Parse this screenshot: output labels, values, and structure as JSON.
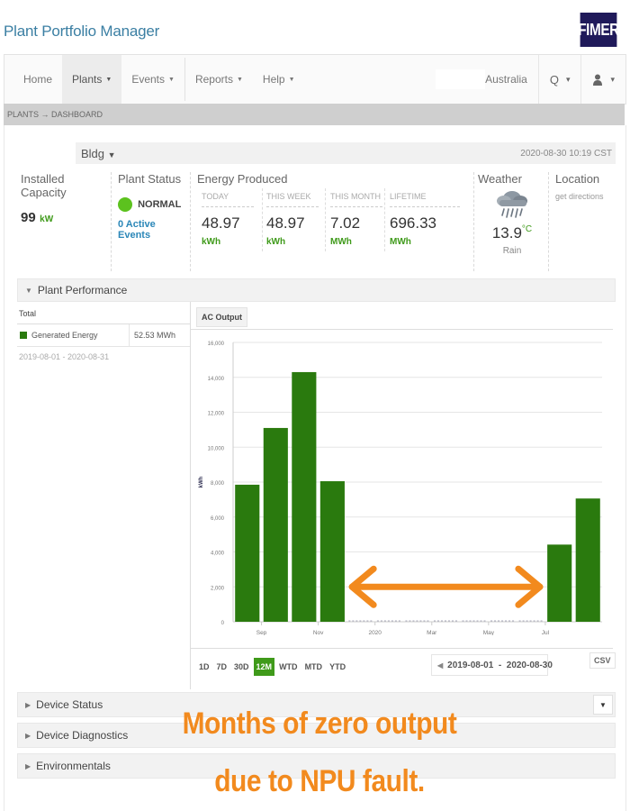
{
  "app": {
    "title": "Plant Portfolio Manager",
    "logo_text": "FIMER",
    "logo_color": "#201a5a"
  },
  "nav": {
    "items": [
      {
        "label": "Home",
        "has_caret": false
      },
      {
        "label": "Plants",
        "has_caret": true,
        "active": true
      },
      {
        "label": "Events",
        "has_caret": true
      },
      {
        "label": "Reports",
        "has_caret": true
      },
      {
        "label": "Help",
        "has_caret": true
      }
    ],
    "caret": "▼",
    "region": "Australia",
    "search_icon": "Q",
    "user_icon": "👤",
    "dropdown_caret": "▾"
  },
  "breadcrumb": {
    "text": "PLANTS → DASHBOARD"
  },
  "plant": {
    "name": "Bldg",
    "caret": "▼",
    "timestamp": "2020-08-30 10:19 CST"
  },
  "kpis": {
    "installed_capacity": {
      "title": "Installed Capacity",
      "value": "99",
      "unit": "kW"
    },
    "plant_status": {
      "title": "Plant Status",
      "status": "NORMAL",
      "events": "0 Active Events",
      "status_color": "#5cc21e"
    },
    "energy": {
      "title": "Energy Produced",
      "items": [
        {
          "label": "TODAY",
          "value": "48.97",
          "unit": "kWh"
        },
        {
          "label": "THIS WEEK",
          "value": "48.97",
          "unit": "kWh"
        },
        {
          "label": "THIS MONTH",
          "value": "7.02",
          "unit": "MWh"
        },
        {
          "label": "LIFETIME",
          "value": "696.33",
          "unit": "MWh"
        }
      ]
    },
    "weather": {
      "title": "Weather",
      "temp": "13.9",
      "unit": "°C",
      "condition": "Rain",
      "icon": "rain-cloud"
    },
    "location": {
      "title": "Location",
      "link": "get directions"
    }
  },
  "performance": {
    "title": "Plant Performance",
    "total_label": "Total",
    "legend": {
      "name": "Generated Energy",
      "value": "52.53 MWh",
      "color": "#2a7a0e"
    },
    "period": "2019-08-01 - 2020-08-31",
    "tab": "AC Output",
    "ranges": [
      "1D",
      "7D",
      "30D",
      "12M",
      "WTD",
      "MTD",
      "YTD"
    ],
    "active_range": "12M",
    "date_range": "2019-08-01  -  2020-08-30",
    "prev_icon": "◀",
    "csv_label": "CSV"
  },
  "chart_data": {
    "type": "bar",
    "title": "",
    "xlabel": "",
    "ylabel": "kWh",
    "ylim": [
      0,
      16000
    ],
    "yticks": [
      0,
      2000,
      4000,
      6000,
      8000,
      10000,
      12000,
      14000,
      16000
    ],
    "ytick_labels": [
      "0",
      "2,000",
      "4,000",
      "6,000",
      "8,000",
      "10,000",
      "12,000",
      "14,000",
      "16,000"
    ],
    "categories": [
      "2019-08",
      "2019-09",
      "2019-10",
      "2019-11",
      "2019-12",
      "2020-01",
      "2020-02",
      "2020-03",
      "2020-04",
      "2020-05",
      "2020-06",
      "2020-07",
      "2020-08"
    ],
    "values": [
      7850,
      11100,
      14300,
      8050,
      0,
      0,
      0,
      0,
      0,
      0,
      0,
      4420,
      7060
    ],
    "xtick_labels": [
      {
        "index": 1,
        "label": "Sep"
      },
      {
        "index": 3,
        "label": "Nov"
      },
      {
        "index": 5,
        "label": "2020"
      },
      {
        "index": 7,
        "label": "Mar"
      },
      {
        "index": 9,
        "label": "May"
      },
      {
        "index": 11,
        "label": "Jul"
      }
    ],
    "series": [
      {
        "name": "Generated Energy",
        "color": "#2a7a0e"
      }
    ],
    "grid": true,
    "annotation": "double-headed arrow spanning zero-output months (Dec 2019 – Jun 2020)"
  },
  "sections": [
    {
      "label": "Device Status",
      "has_dropdown": true
    },
    {
      "label": "Device Diagnostics"
    },
    {
      "label": "Environmentals"
    }
  ],
  "annotation": {
    "line1": "Months of zero output",
    "line2": "due to NPU fault.",
    "color": "#f28a1e"
  }
}
